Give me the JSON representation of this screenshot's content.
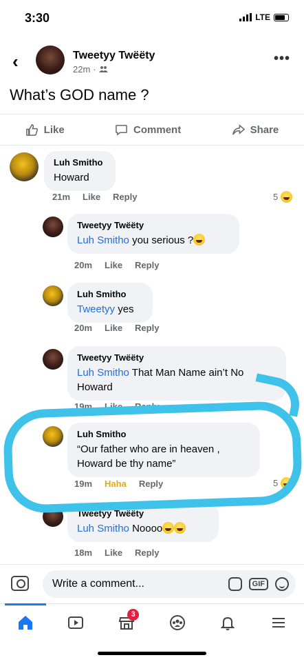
{
  "status": {
    "time": "3:30",
    "network": "LTE"
  },
  "post": {
    "author": "Tweetyy Twëëty",
    "time": "22m",
    "privacy_icon": "friends-icon",
    "text": "What’s GOD name ?"
  },
  "actions": {
    "like": "Like",
    "comment": "Comment",
    "share": "Share"
  },
  "comments": [
    {
      "author": "Luh Smitho",
      "mention": "",
      "text": "Howard",
      "time": "21m",
      "like": "Like",
      "reply": "Reply",
      "reactions": "5"
    },
    {
      "author": "Tweetyy Twëëty",
      "mention": "Luh Smitho",
      "text": "you serious ?",
      "time": "20m",
      "like": "Like",
      "reply": "Reply"
    },
    {
      "author": "Luh Smitho",
      "mention": "Tweetyy",
      "text": "yes",
      "time": "20m",
      "like": "Like",
      "reply": "Reply"
    },
    {
      "author": "Tweetyy Twëëty",
      "mention": "Luh Smitho",
      "text": "That Man Name ain’t No Howard",
      "time": "19m",
      "like": "Like",
      "reply": "Reply"
    },
    {
      "author": "Luh Smitho",
      "mention": "",
      "text": "“Our father who are in heaven , Howard be thy name”",
      "time": "19m",
      "like": "Haha",
      "reply": "Reply",
      "reactions": "5"
    },
    {
      "author": "Tweetyy Twëëty",
      "mention": "Luh Smitho",
      "text": "Noooo",
      "time": "18m",
      "like": "Like",
      "reply": "Reply"
    }
  ],
  "composer": {
    "placeholder": "Write a comment...",
    "gif": "GIF"
  },
  "tabbar": {
    "notifications_badge": "3"
  },
  "colors": {
    "accent": "#1877f2",
    "mention": "#216fdb",
    "highlight": "#3ec2ea",
    "haha": "#e3a90d",
    "badge": "#e41e3f"
  }
}
